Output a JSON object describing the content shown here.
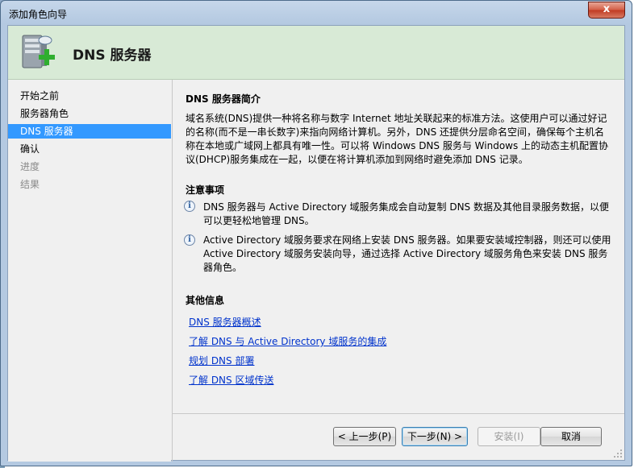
{
  "window": {
    "title": "添加角色向导",
    "close_label": "x"
  },
  "header": {
    "title": "DNS 服务器"
  },
  "nav": {
    "items": [
      {
        "label": "开始之前",
        "state": "normal"
      },
      {
        "label": "服务器角色",
        "state": "normal"
      },
      {
        "label": "DNS 服务器",
        "state": "active"
      },
      {
        "label": "确认",
        "state": "normal"
      },
      {
        "label": "进度",
        "state": "disabled"
      },
      {
        "label": "结果",
        "state": "disabled"
      }
    ]
  },
  "content": {
    "intro_heading": "DNS 服务器简介",
    "intro_text": "域名系统(DNS)提供一种将名称与数字 Internet 地址关联起来的标准方法。这使用户可以通过好记的名称(而不是一串长数字)来指向网络计算机。另外，DNS 还提供分层命名空间，确保每个主机名称在本地或广域网上都具有唯一性。可以将 Windows DNS 服务与 Windows 上的动态主机配置协议(DHCP)服务集成在一起，以便在将计算机添加到网络时避免添加 DNS 记录。",
    "notes_heading": "注意事项",
    "notes": [
      "DNS 服务器与 Active Directory 域服务集成会自动复制 DNS 数据及其他目录服务数据，以便可以更轻松地管理 DNS。",
      "Active Directory 域服务要求在网络上安装 DNS 服务器。如果要安装域控制器，则还可以使用 Active Directory 域服务安装向导，通过选择 Active Directory 域服务角色来安装 DNS 服务器角色。"
    ],
    "more_heading": "其他信息",
    "links": [
      "DNS 服务器概述",
      "了解 DNS 与 Active Directory 域服务的集成",
      "规划 DNS 部署",
      "了解 DNS 区域传送"
    ]
  },
  "buttons": {
    "back": "< 上一步(P)",
    "next": "下一步(N) >",
    "install": "安装(I)",
    "cancel": "取消"
  }
}
